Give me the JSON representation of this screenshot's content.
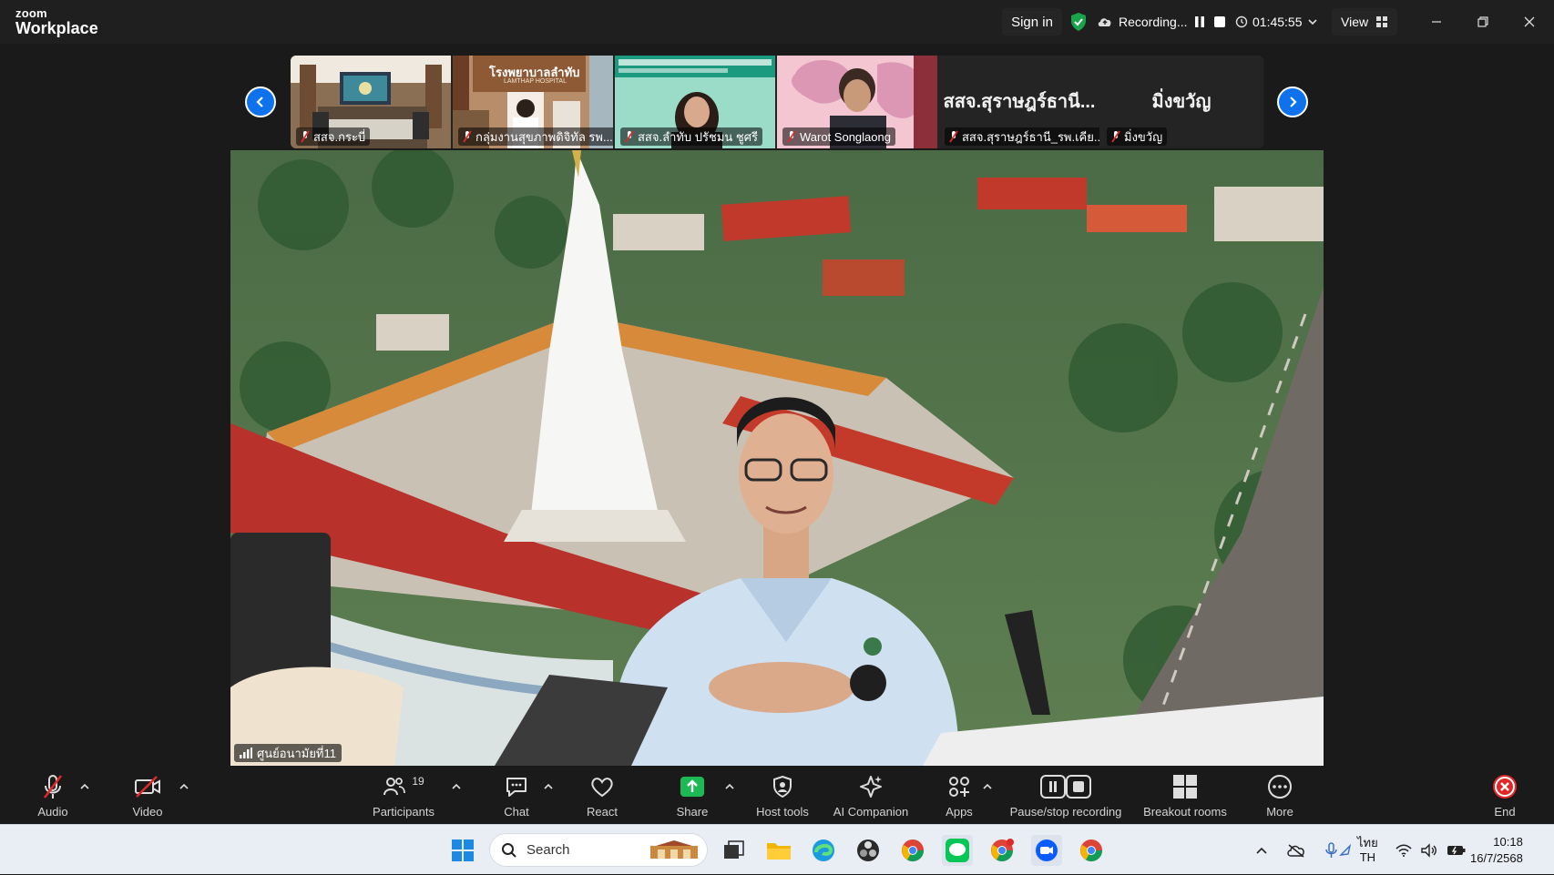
{
  "app": {
    "logo_small": "zoom",
    "logo_big": "Workplace"
  },
  "titlebar": {
    "signin": "Sign in",
    "recording": "Recording...",
    "timer": "01:45:55",
    "view": "View"
  },
  "participants_strip": [
    {
      "name": "สสจ.กระบี่",
      "muted": true
    },
    {
      "name": "กลุ่มงานสุขภาพดิจิทัล รพ...",
      "muted": true
    },
    {
      "name": "สสจ.ลำทับ ปรัชมน ชูศรี",
      "muted": true
    },
    {
      "name": "Warot Songlaong",
      "muted": true
    },
    {
      "name": "สสจ.สุราษฎร์ธานี_รพ.เคีย...",
      "muted": true,
      "display_name": "สสจ.สุราษฎร์ธานี..."
    },
    {
      "name": "มิ่งขวัญ",
      "muted": true,
      "display_name": "มิ่งขวัญ"
    }
  ],
  "tile_texts": {
    "hospital_sign": "โรงพยาบาลลำทับ",
    "hospital_sign_en": "LAMTHAP HOSPITAL"
  },
  "main_video": {
    "label": "ศูนย์อนามัยที่11"
  },
  "toolbar": {
    "audio": "Audio",
    "video": "Video",
    "participants": "Participants",
    "participants_count": "19",
    "chat": "Chat",
    "react": "React",
    "share": "Share",
    "host_tools": "Host tools",
    "ai_companion": "AI Companion",
    "apps": "Apps",
    "pause_stop": "Pause/stop recording",
    "breakout": "Breakout rooms",
    "more": "More",
    "end": "End"
  },
  "taskbar": {
    "search_placeholder": "Search",
    "lang_top": "ไทย",
    "lang_bottom": "TH",
    "time": "10:18",
    "date": "16/7/2568"
  },
  "colors": {
    "zoom_blue": "#0e72ed",
    "share_green": "#1db954",
    "muted_red": "#e02828",
    "shield_green": "#1aa34a"
  }
}
